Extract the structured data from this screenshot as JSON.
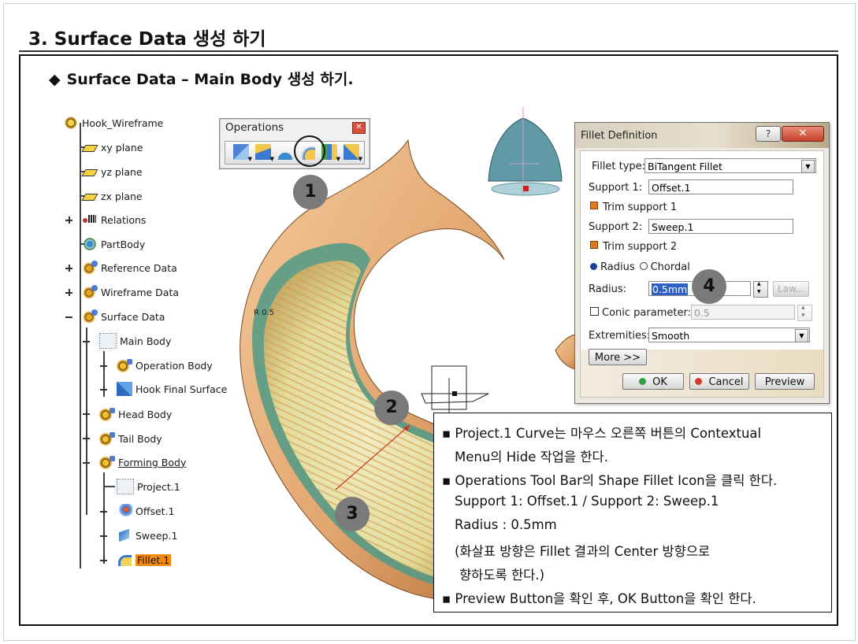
{
  "page_title": "3. Surface Data 생성 하기",
  "section": {
    "bullet": "◆",
    "title": "Surface Data – Main Body 생성 하기."
  },
  "tree": {
    "root": "Hook_Wireframe",
    "items": [
      {
        "label": "xy plane",
        "icon": "plane-icon"
      },
      {
        "label": "yz plane",
        "icon": "plane-icon"
      },
      {
        "label": "zx plane",
        "icon": "plane-icon"
      },
      {
        "label": "Relations",
        "icon": "relations-icon"
      },
      {
        "label": "PartBody",
        "icon": "partbody-icon"
      },
      {
        "label": "Reference Data",
        "icon": "geometric-set-icon"
      },
      {
        "label": "Wireframe Data",
        "icon": "geometric-set-icon"
      },
      {
        "label": "Surface Data",
        "icon": "geometric-set-icon"
      },
      {
        "label": "Main Body",
        "icon": "main-body-icon"
      },
      {
        "label": "Operation Body",
        "icon": "geometric-set-icon"
      },
      {
        "label": "Hook Final Surface",
        "icon": "surface-icon"
      },
      {
        "label": "Head Body",
        "icon": "geometric-set-icon"
      },
      {
        "label": "Tail Body",
        "icon": "geometric-set-icon"
      },
      {
        "label": "Forming Body",
        "icon": "geometric-set-icon"
      },
      {
        "label": "Project.1",
        "icon": "projection-icon"
      },
      {
        "label": "Offset.1",
        "icon": "offset-icon"
      },
      {
        "label": "Sweep.1",
        "icon": "sweep-icon"
      },
      {
        "label": "Fillet.1",
        "icon": "fillet-icon"
      }
    ]
  },
  "operations_toolbar": {
    "title": "Operations",
    "close": "✕",
    "buttons": [
      "join-icon",
      "split-icon",
      "trim-icon",
      "shape-fillet-icon",
      "extract-icon",
      "transform-icon"
    ]
  },
  "badges": [
    "1",
    "2",
    "3",
    "4"
  ],
  "model_label": "R 0.5",
  "fillet_dialog": {
    "title": "Fillet Definition",
    "help": "?",
    "close": "✕",
    "fillet_type_label": "Fillet type:",
    "fillet_type_value": "BiTangent Fillet",
    "support1_label": "Support 1:",
    "support1_value": "Offset.1",
    "trim_support1": "Trim support 1",
    "support2_label": "Support 2:",
    "support2_value": "Sweep.1",
    "trim_support2": "Trim support 2",
    "radius_option": "Radius",
    "chordal_option": "Chordal",
    "radius_label": "Radius:",
    "radius_value": "0.5mm",
    "law_button": "Law...",
    "conic_label": "Conic parameter:",
    "conic_value": "0.5",
    "extremities_label": "Extremities:",
    "extremities_value": "Smooth",
    "more_button": "More >>",
    "ok_button": "OK",
    "cancel_button": "Cancel",
    "preview_button": "Preview",
    "colors": {
      "ok": "#2ea043",
      "cancel": "#d63a2a"
    }
  },
  "notes": {
    "line1": "▪ Project.1 Curve는 마우스 오른쪽 버튼의 Contextual",
    "line2": "Menu의 Hide 작업을 한다.",
    "line3": "▪ Operations Tool Bar의 Shape Fillet Icon을 클릭 한다.",
    "line4": "Support 1: Offset.1 / Support 2: Sweep.1",
    "line5": "Radius : 0.5mm",
    "line6": "(화살표 방향은 Fillet 결과의 Center 방향으로",
    "line7": "향하도록 한다.)",
    "line8": "▪ Preview Button을 확인 후, OK Button을 확인 한다."
  },
  "colors": {
    "surface": "#e8b07a",
    "surface_dark": "#b8773e",
    "fillet_green": "#4f9a86",
    "inner": "#e9e3a8"
  }
}
